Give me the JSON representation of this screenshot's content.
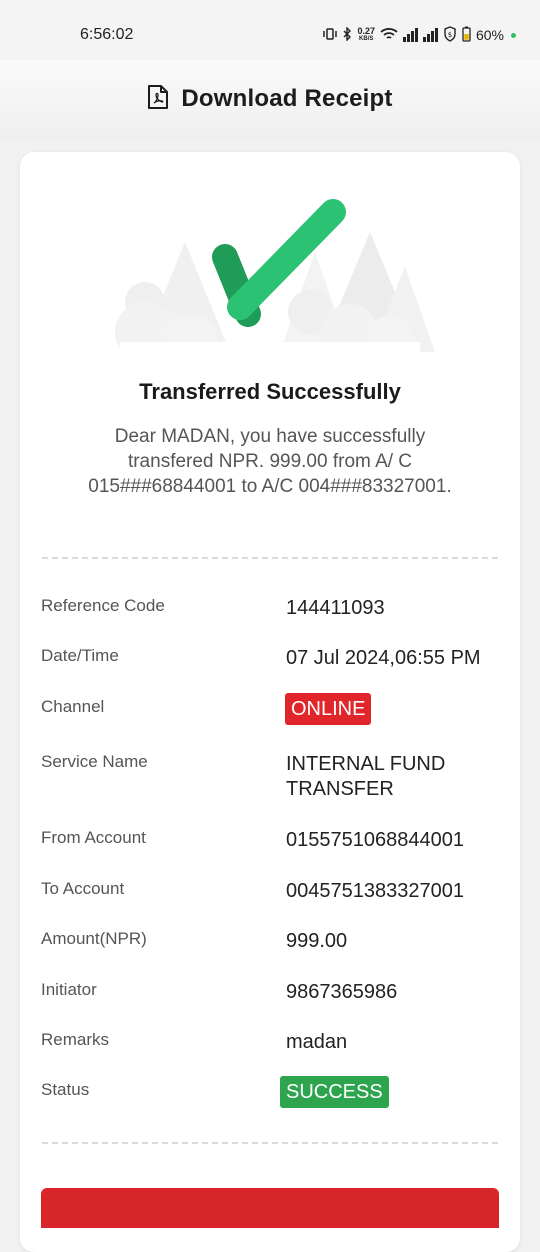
{
  "status_bar": {
    "time": "6:56:02",
    "speed_value": "0.27",
    "speed_unit": "KB/S",
    "battery": "60%"
  },
  "header": {
    "title": "Download Receipt",
    "icon": "pdf-file-icon"
  },
  "receipt": {
    "title": "Transferred Successfully",
    "message": "Dear MADAN, you have successfully transfered NPR. 999.00 from A/ C 015###68844001 to A/C 004###83327001.",
    "rows": [
      {
        "label": "Reference Code",
        "value": "144411093"
      },
      {
        "label": "Date/Time",
        "value": "07 Jul 2024,06:55 PM"
      },
      {
        "label": "Channel",
        "value": "ONLINE"
      },
      {
        "label": "Service Name",
        "value": "INTERNAL FUND TRANSFER"
      },
      {
        "label": "From Account",
        "value": "0155751068844001"
      },
      {
        "label": "To Account",
        "value": "0045751383327001"
      },
      {
        "label": "Amount(NPR)",
        "value": "999.00"
      },
      {
        "label": "Initiator",
        "value": "9867365986"
      },
      {
        "label": "Remarks",
        "value": "madan"
      },
      {
        "label": "Status",
        "value": "SUCCESS"
      }
    ]
  },
  "colors": {
    "accent_red": "#e0262b",
    "success_green": "#2ea44f",
    "check_green": "#2bc274"
  }
}
